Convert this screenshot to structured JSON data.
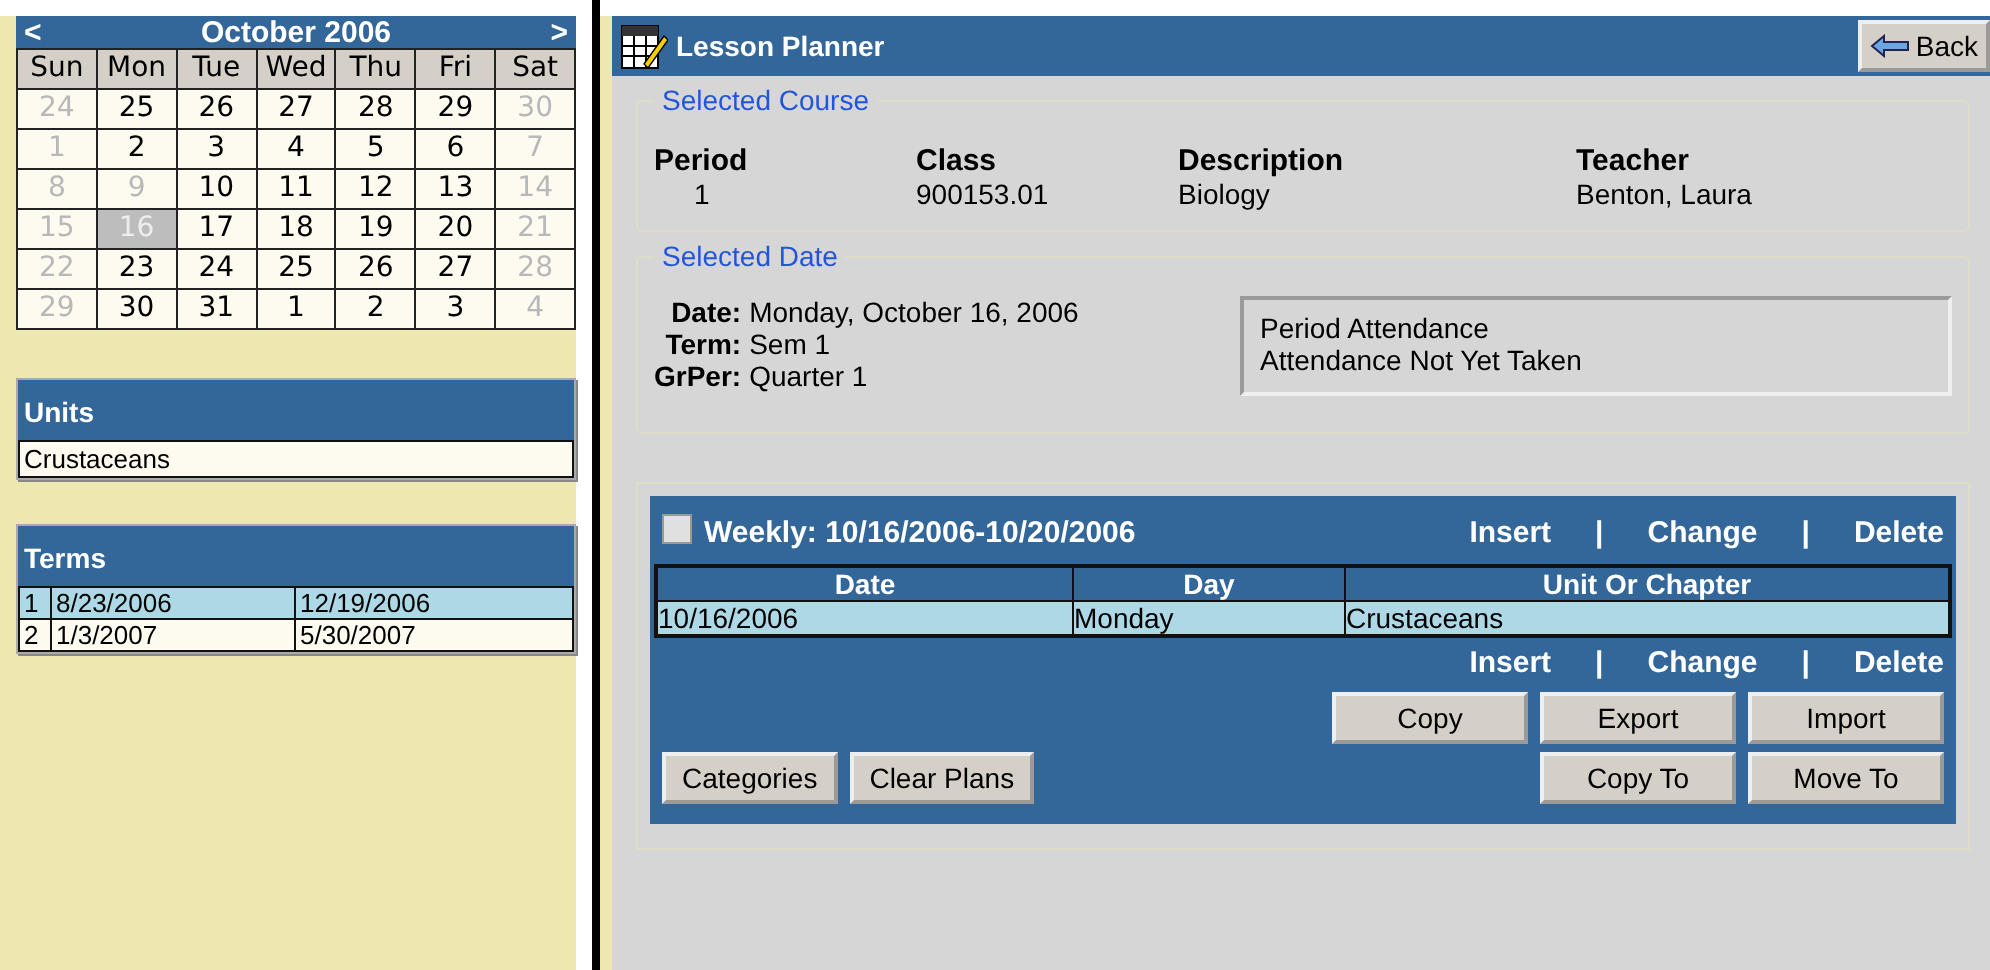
{
  "calendar": {
    "prev": "<",
    "title": "October 2006",
    "next": ">",
    "weekdays": [
      "Sun",
      "Mon",
      "Tue",
      "Wed",
      "Thu",
      "Fri",
      "Sat"
    ],
    "weeks": [
      [
        {
          "day": "24",
          "muted": true,
          "selected": false
        },
        {
          "day": "25",
          "muted": false,
          "selected": false
        },
        {
          "day": "26",
          "muted": false,
          "selected": false
        },
        {
          "day": "27",
          "muted": false,
          "selected": false
        },
        {
          "day": "28",
          "muted": false,
          "selected": false
        },
        {
          "day": "29",
          "muted": false,
          "selected": false
        },
        {
          "day": "30",
          "muted": true,
          "selected": false
        }
      ],
      [
        {
          "day": "1",
          "muted": true,
          "selected": false
        },
        {
          "day": "2",
          "muted": false,
          "selected": false
        },
        {
          "day": "3",
          "muted": false,
          "selected": false
        },
        {
          "day": "4",
          "muted": false,
          "selected": false
        },
        {
          "day": "5",
          "muted": false,
          "selected": false
        },
        {
          "day": "6",
          "muted": false,
          "selected": false
        },
        {
          "day": "7",
          "muted": true,
          "selected": false
        }
      ],
      [
        {
          "day": "8",
          "muted": true,
          "selected": false
        },
        {
          "day": "9",
          "muted": true,
          "selected": false
        },
        {
          "day": "10",
          "muted": false,
          "selected": false
        },
        {
          "day": "11",
          "muted": false,
          "selected": false
        },
        {
          "day": "12",
          "muted": false,
          "selected": false
        },
        {
          "day": "13",
          "muted": false,
          "selected": false
        },
        {
          "day": "14",
          "muted": true,
          "selected": false
        }
      ],
      [
        {
          "day": "15",
          "muted": true,
          "selected": false
        },
        {
          "day": "16",
          "muted": true,
          "selected": true
        },
        {
          "day": "17",
          "muted": false,
          "selected": false
        },
        {
          "day": "18",
          "muted": false,
          "selected": false
        },
        {
          "day": "19",
          "muted": false,
          "selected": false
        },
        {
          "day": "20",
          "muted": false,
          "selected": false
        },
        {
          "day": "21",
          "muted": true,
          "selected": false
        }
      ],
      [
        {
          "day": "22",
          "muted": true,
          "selected": false
        },
        {
          "day": "23",
          "muted": false,
          "selected": false
        },
        {
          "day": "24",
          "muted": false,
          "selected": false
        },
        {
          "day": "25",
          "muted": false,
          "selected": false
        },
        {
          "day": "26",
          "muted": false,
          "selected": false
        },
        {
          "day": "27",
          "muted": false,
          "selected": false
        },
        {
          "day": "28",
          "muted": true,
          "selected": false
        }
      ],
      [
        {
          "day": "29",
          "muted": true,
          "selected": false
        },
        {
          "day": "30",
          "muted": false,
          "selected": false
        },
        {
          "day": "31",
          "muted": false,
          "selected": false
        },
        {
          "day": "1",
          "muted": false,
          "selected": false
        },
        {
          "day": "2",
          "muted": false,
          "selected": false
        },
        {
          "day": "3",
          "muted": false,
          "selected": false
        },
        {
          "day": "4",
          "muted": true,
          "selected": false
        }
      ]
    ]
  },
  "units": {
    "title": "Units",
    "items": [
      "Crustaceans"
    ]
  },
  "terms": {
    "title": "Terms",
    "rows": [
      {
        "cells": [
          "1",
          "8/23/2006",
          "12/19/2006"
        ],
        "selected": true
      },
      {
        "cells": [
          "2",
          "1/3/2007",
          "5/30/2007"
        ],
        "selected": false
      }
    ]
  },
  "header": {
    "title": "Lesson Planner",
    "back": "Back"
  },
  "selected_course": {
    "legend": "Selected Course",
    "columns": [
      {
        "label": "Period",
        "value": "1"
      },
      {
        "label": "Class",
        "value": "900153.01"
      },
      {
        "label": "Description",
        "value": "Biology"
      },
      {
        "label": "Teacher",
        "value": "Benton, Laura"
      }
    ]
  },
  "selected_date": {
    "legend": "Selected Date",
    "fields": [
      {
        "label": "Date:",
        "value": "Monday, October 16, 2006"
      },
      {
        "label": "Term:",
        "value": "Sem 1"
      },
      {
        "label": "GrPer:",
        "value": "Quarter 1"
      }
    ],
    "attendance": [
      "Period Attendance",
      "Attendance Not Yet Taken"
    ]
  },
  "weekly": {
    "checked": false,
    "title": "Weekly: 10/16/2006-10/20/2006",
    "actions": [
      "Insert",
      "|",
      "Change",
      "|",
      "Delete"
    ],
    "columns": [
      "Date",
      "Day",
      "Unit Or Chapter"
    ],
    "rows": [
      {
        "cells": [
          "10/16/2006",
          "Monday",
          "Crustaceans"
        ],
        "selected": true
      }
    ],
    "bottom_actions": [
      "Insert",
      "|",
      "Change",
      "|",
      "Delete"
    ],
    "left_buttons": [
      "Categories",
      "Clear Plans"
    ],
    "right_buttons": [
      "Copy",
      "Export",
      "Import",
      "Copy To",
      "Move To"
    ]
  }
}
